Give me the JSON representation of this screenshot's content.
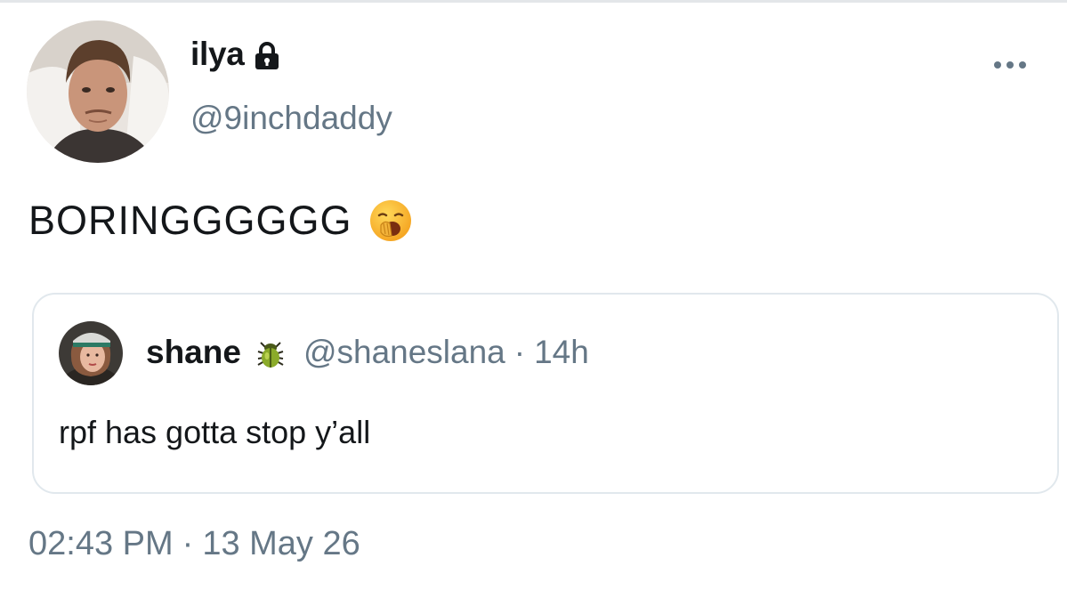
{
  "author": {
    "display_name": "ilya",
    "handle": "@9inchdaddy",
    "avatar_icon": "profile-photo",
    "protected_icon": "lock-icon"
  },
  "tweet": {
    "text": "BORINGGGGGG",
    "emoji": "yawning-face-emoji"
  },
  "quoted_tweet": {
    "display_name": "shane",
    "name_emoji": "beetle-emoji",
    "handle": "@shaneslana",
    "separator": "·",
    "relative_time": "14h",
    "text": "rpf has gotta stop y’all"
  },
  "meta": {
    "time": "02:43 PM",
    "separator": "·",
    "date": "13 May 26"
  },
  "menu": {
    "icon": "more-options-icon"
  },
  "colors": {
    "text_primary": "#14171a",
    "text_secondary": "#657786",
    "card_border": "#e1e8ed"
  }
}
